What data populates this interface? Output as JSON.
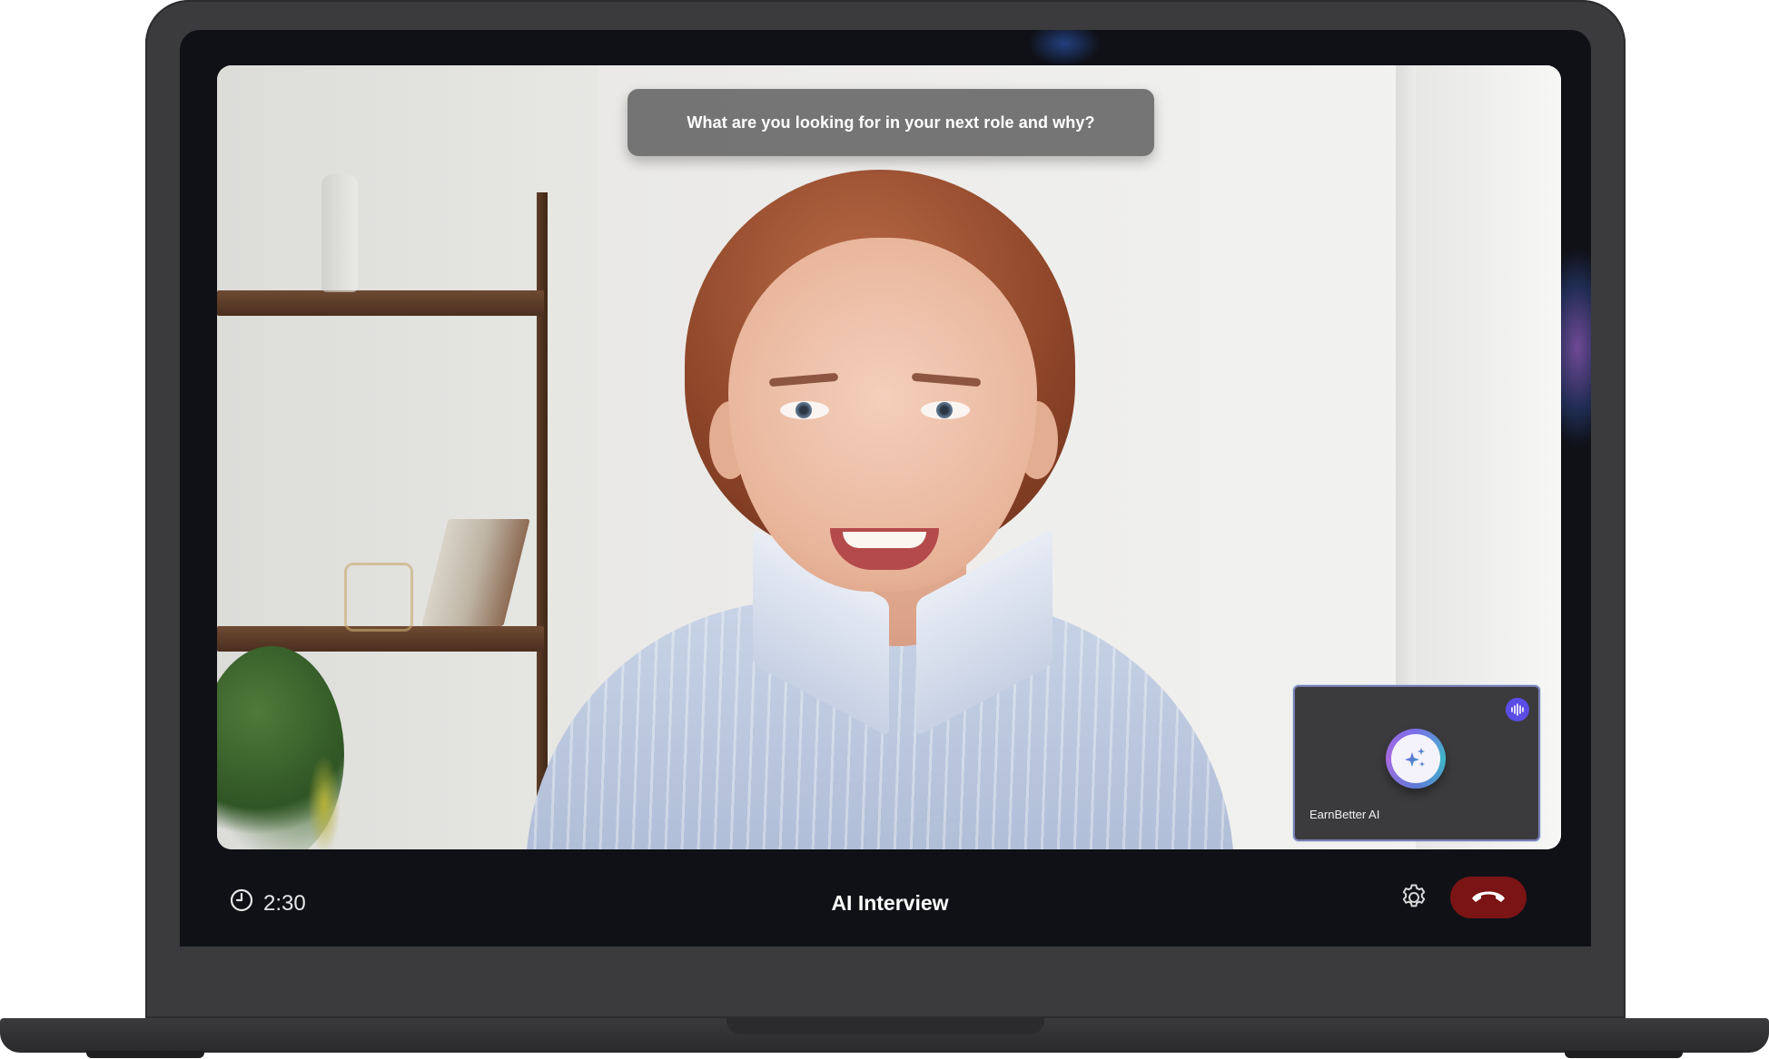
{
  "interview": {
    "question": "What are you looking for in your next role and why?",
    "title": "AI Interview",
    "timer": "2:30"
  },
  "ai_participant": {
    "name": "EarnBetter AI",
    "avatar_icon": "sparkles-icon",
    "badge_icon": "audio-waveform-icon"
  },
  "controls": {
    "timer_icon": "clock-icon",
    "settings_icon": "gear-icon",
    "end_call_icon": "phone-hangup-icon",
    "end_call_color": "#7b1414"
  },
  "colors": {
    "accent": "#5b4ce6",
    "bezel": "#0f1117",
    "laptop_body": "#3b3b3d"
  }
}
